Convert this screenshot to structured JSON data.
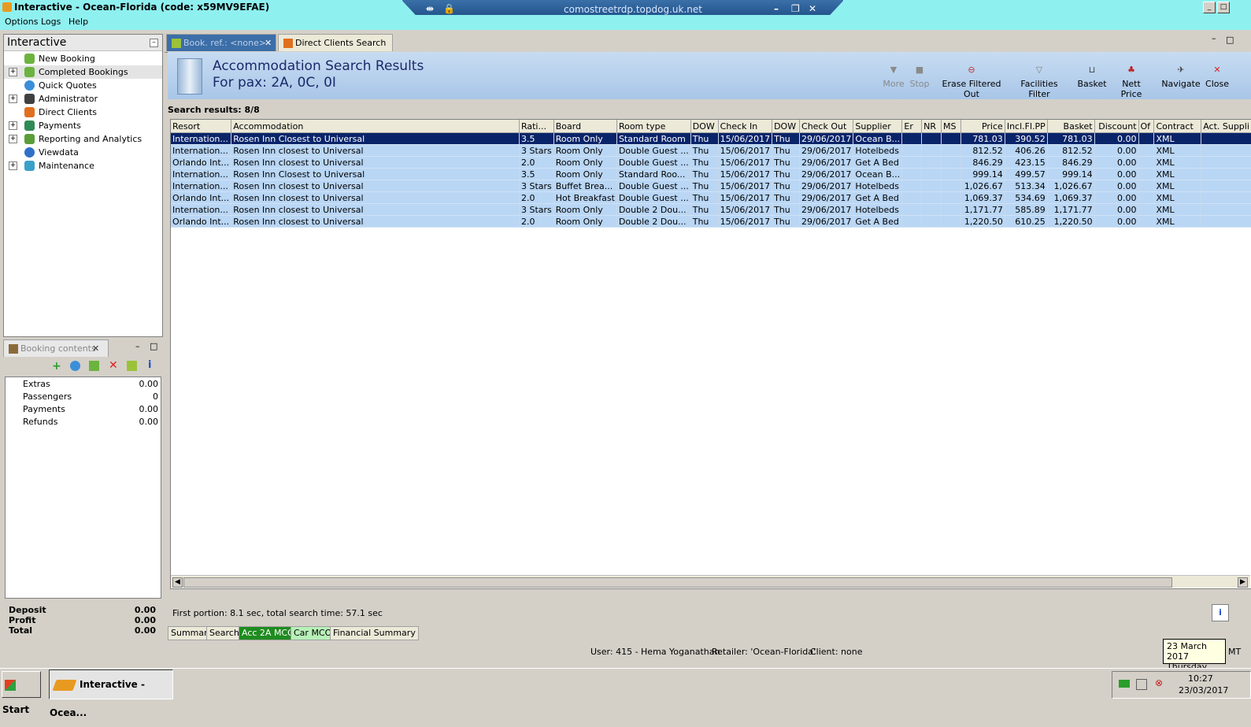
{
  "window": {
    "title": "Interactive - Ocean-Florida (code: x59MV9EFAE)"
  },
  "rdp": {
    "host": "comostreetrdp.topdog.uk.net"
  },
  "menu": [
    "Options",
    "Logs",
    "Help"
  ],
  "nav": {
    "title": "Interactive",
    "items": [
      {
        "label": "New Booking",
        "expandable": false
      },
      {
        "label": "Completed Bookings",
        "expandable": true
      },
      {
        "label": "Quick Quotes",
        "expandable": false
      },
      {
        "label": "Administrator",
        "expandable": true
      },
      {
        "label": "Direct Clients",
        "expandable": false
      },
      {
        "label": "Payments",
        "expandable": true
      },
      {
        "label": "Reporting and Analytics",
        "expandable": true
      },
      {
        "label": "Viewdata",
        "expandable": false
      },
      {
        "label": "Maintenance",
        "expandable": true
      }
    ]
  },
  "booking": {
    "title": "Booking contents",
    "items": [
      {
        "label": "Extras",
        "value": "0.00"
      },
      {
        "label": "Passengers",
        "value": "0"
      },
      {
        "label": "Payments",
        "value": "0.00"
      },
      {
        "label": "Refunds",
        "value": "0.00"
      }
    ],
    "totals": [
      {
        "label": "Deposit",
        "value": "0.00"
      },
      {
        "label": "Profit",
        "value": "0.00"
      },
      {
        "label": "Total",
        "value": "0.00"
      }
    ]
  },
  "tabs": [
    {
      "label": "Book. ref.: <none>",
      "active": true
    },
    {
      "label": "Direct Clients Search",
      "active": false
    }
  ],
  "header": {
    "title": "Accommodation Search Results",
    "subtitle": "For pax: 2A, 0C, 0I"
  },
  "toolbar": {
    "more": "More",
    "stop": "Stop",
    "erase": "Erase Filtered Out",
    "facilities": "Facilities Filter",
    "basket": "Basket",
    "nett": "Nett Price",
    "navigate": "Navigate",
    "close": "Close"
  },
  "results": {
    "count_text": "Search results: 8/8",
    "columns": [
      "Resort",
      "Accommodation",
      "Rati...",
      "Board",
      "Room type",
      "DOW",
      "Check In",
      "DOW",
      "Check Out",
      "Supplier",
      "Er",
      "NR",
      "MS",
      "Price",
      "Incl.Fl.PP",
      "Basket",
      "Discount",
      "Of",
      "Contract",
      "Act. Suppli"
    ],
    "rows": [
      [
        "Internation...",
        "Rosen Inn Closest to Universal",
        "3.5",
        "Room Only",
        "Standard Room",
        "Thu",
        "15/06/2017",
        "Thu",
        "29/06/2017",
        "Ocean B...",
        "",
        "",
        "",
        "781.03",
        "390.52",
        "781.03",
        "0.00",
        "",
        "XML",
        ""
      ],
      [
        "Internation...",
        "Rosen Inn closest to Universal",
        "3 Stars",
        "Room Only",
        "Double Guest ...",
        "Thu",
        "15/06/2017",
        "Thu",
        "29/06/2017",
        "Hotelbeds",
        "",
        "",
        "",
        "812.52",
        "406.26",
        "812.52",
        "0.00",
        "",
        "XML",
        ""
      ],
      [
        "Orlando Int...",
        "Rosen Inn closest to Universal",
        "2.0",
        "Room Only",
        "Double Guest ...",
        "Thu",
        "15/06/2017",
        "Thu",
        "29/06/2017",
        "Get A Bed",
        "",
        "",
        "",
        "846.29",
        "423.15",
        "846.29",
        "0.00",
        "",
        "XML",
        ""
      ],
      [
        "Internation...",
        "Rosen Inn Closest to Universal",
        "3.5",
        "Room Only",
        "Standard Roo...",
        "Thu",
        "15/06/2017",
        "Thu",
        "29/06/2017",
        "Ocean B...",
        "",
        "",
        "",
        "999.14",
        "499.57",
        "999.14",
        "0.00",
        "",
        "XML",
        ""
      ],
      [
        "Internation...",
        "Rosen Inn closest to Universal",
        "3 Stars",
        "Buffet Brea...",
        "Double Guest ...",
        "Thu",
        "15/06/2017",
        "Thu",
        "29/06/2017",
        "Hotelbeds",
        "",
        "",
        "",
        "1,026.67",
        "513.34",
        "1,026.67",
        "0.00",
        "",
        "XML",
        ""
      ],
      [
        "Orlando Int...",
        "Rosen Inn closest to Universal",
        "2.0",
        "Hot Breakfast",
        "Double Guest ...",
        "Thu",
        "15/06/2017",
        "Thu",
        "29/06/2017",
        "Get A Bed",
        "",
        "",
        "",
        "1,069.37",
        "534.69",
        "1,069.37",
        "0.00",
        "",
        "XML",
        ""
      ],
      [
        "Internation...",
        "Rosen Inn closest to Universal",
        "3 Stars",
        "Room Only",
        "Double 2  Dou...",
        "Thu",
        "15/06/2017",
        "Thu",
        "29/06/2017",
        "Hotelbeds",
        "",
        "",
        "",
        "1,171.77",
        "585.89",
        "1,171.77",
        "0.00",
        "",
        "XML",
        ""
      ],
      [
        "Orlando Int...",
        "Rosen Inn closest to Universal",
        "2.0",
        "Room Only",
        "Double 2  Dou...",
        "Thu",
        "15/06/2017",
        "Thu",
        "29/06/2017",
        "Get A Bed",
        "",
        "",
        "",
        "1,220.50",
        "610.25",
        "1,220.50",
        "0.00",
        "",
        "XML",
        ""
      ]
    ]
  },
  "status": {
    "timing": "First portion: 8.1 sec, total search time: 57.1 sec",
    "user": "User: 415 - Hema Yoganathan",
    "retailer": "Retailer: 'Ocean-Florida'",
    "client": "Client: none"
  },
  "bottom_tabs": [
    "Summary",
    "Search",
    "Acc 2A MCO",
    "Car MCO",
    "Financial Summary"
  ],
  "tooltip": {
    "date": "23 March 2017",
    "day": "Thursday"
  },
  "taskbar": {
    "start": "Start",
    "task": "Interactive - Ocea...",
    "time": "10:27",
    "date": "23/03/2017",
    "edge_text": "MT"
  },
  "colors": {
    "titlebar": "#8ff0f0",
    "selection": "#0a246a",
    "row": "#b9d6f5",
    "accent_tab": "#1e8c1e"
  }
}
